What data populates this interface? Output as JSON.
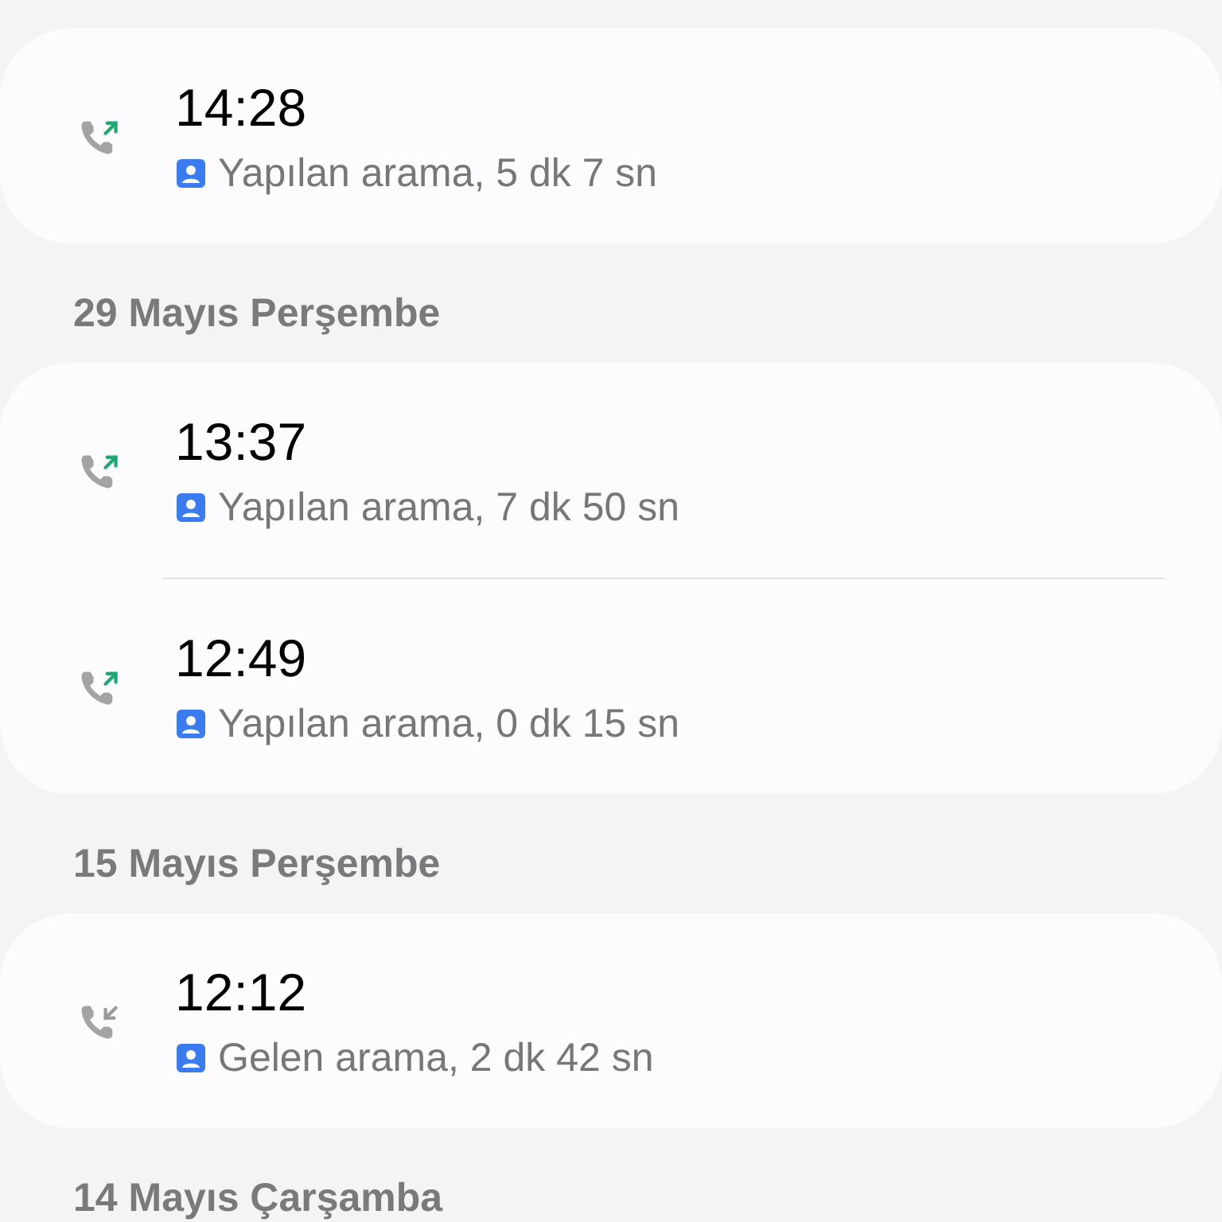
{
  "sections": [
    {
      "calls": [
        {
          "kind": "outgoing",
          "time": "14:28",
          "detail": "Yapılan arama, 5 dk 7 sn"
        }
      ]
    },
    {
      "header": "29 Mayıs Perşembe",
      "calls": [
        {
          "kind": "outgoing",
          "time": "13:37",
          "detail": "Yapılan arama, 7 dk 50 sn"
        },
        {
          "kind": "outgoing",
          "time": "12:49",
          "detail": "Yapılan arama, 0 dk 15 sn"
        }
      ]
    },
    {
      "header": "15 Mayıs Perşembe",
      "calls": [
        {
          "kind": "incoming",
          "time": "12:12",
          "detail": "Gelen arama, 2 dk 42 sn"
        }
      ]
    },
    {
      "header": "14 Mayıs Çarşamba"
    }
  ]
}
